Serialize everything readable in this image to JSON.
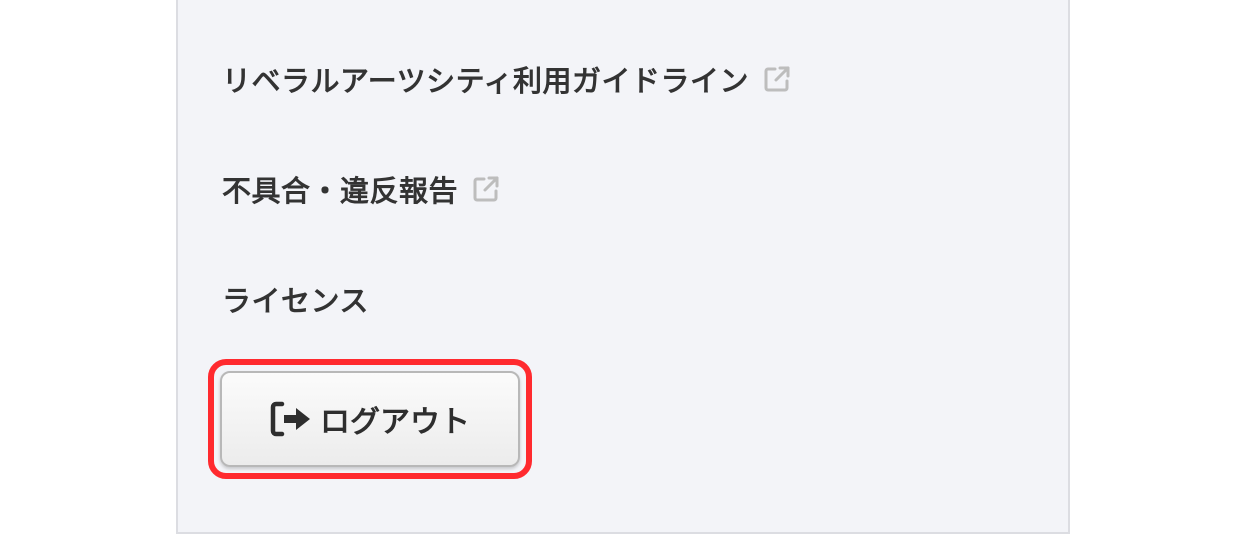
{
  "menu": {
    "items": [
      {
        "label": "リベラルアーツシティ利用ガイドライン",
        "icon": "external-link-icon"
      },
      {
        "label": "不具合・違反報告",
        "icon": "external-link-icon"
      },
      {
        "label": "ライセンス"
      }
    ]
  },
  "logout": {
    "label": "ログアウト",
    "icon": "sign-out-icon"
  },
  "colors": {
    "panel_background": "#f3f4f8",
    "highlight": "#ff2a2f",
    "text": "#333333",
    "external_icon": "#bdbdbd"
  }
}
